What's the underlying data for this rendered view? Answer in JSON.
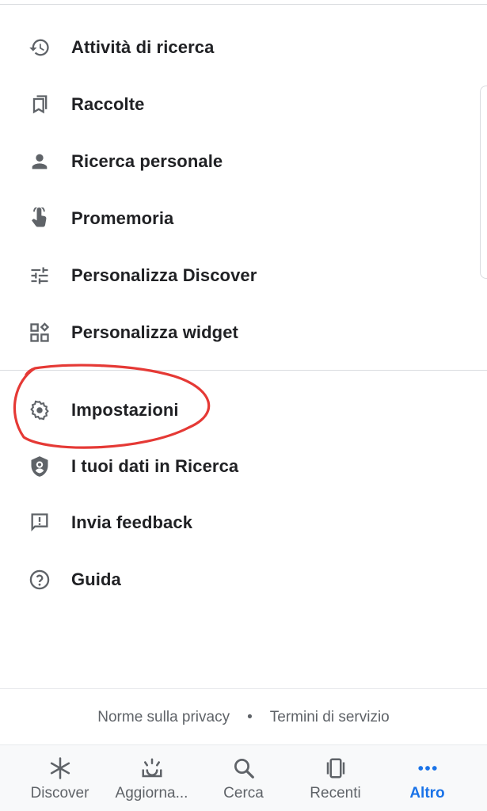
{
  "menu": {
    "items": [
      {
        "label": "Attività di ricerca",
        "icon": "history-icon"
      },
      {
        "label": "Raccolte",
        "icon": "bookmarks-icon"
      },
      {
        "label": "Ricerca personale",
        "icon": "person-icon"
      },
      {
        "label": "Promemoria",
        "icon": "touch-hand-icon"
      },
      {
        "label": "Personalizza Discover",
        "icon": "tune-icon"
      },
      {
        "label": "Personalizza widget",
        "icon": "widgets-icon"
      }
    ],
    "secondary_items": [
      {
        "label": "Impostazioni",
        "icon": "gear-icon"
      },
      {
        "label": "I tuoi dati in Ricerca",
        "icon": "shield-person-icon"
      },
      {
        "label": "Invia feedback",
        "icon": "feedback-icon"
      },
      {
        "label": "Guida",
        "icon": "help-icon"
      }
    ]
  },
  "footer": {
    "privacy": "Norme sulla privacy",
    "separator": "•",
    "terms": "Termini di servizio"
  },
  "bottom_nav": {
    "items": [
      {
        "label": "Discover",
        "icon": "asterisk-icon",
        "active": false
      },
      {
        "label": "Aggiorna...",
        "icon": "updates-icon",
        "active": false
      },
      {
        "label": "Cerca",
        "icon": "search-icon",
        "active": false
      },
      {
        "label": "Recenti",
        "icon": "recents-icon",
        "active": false
      },
      {
        "label": "Altro",
        "icon": "more-dots-icon",
        "active": true
      }
    ]
  },
  "colors": {
    "accent": "#1a73e8",
    "annotation": "#e53935",
    "icon": "#5f6368"
  }
}
